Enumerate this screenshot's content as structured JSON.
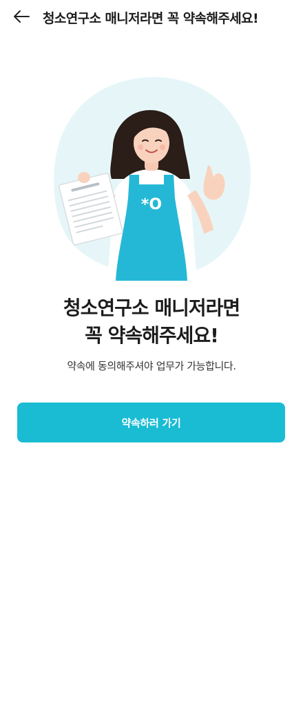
{
  "header": {
    "title": "청소연구소 매니저라면 꼭 약속해주세요!"
  },
  "hero": {
    "title_line1": "청소연구소 매니저라면",
    "title_line2": "꼭 약속해주세요!",
    "subtitle": "약속에 동의해주셔야 업무가 가능합니다."
  },
  "cta": {
    "label": "약속하러 가기"
  },
  "icons": {
    "back": "arrow-left-icon",
    "illustration": "manager-with-document-illustration"
  },
  "colors": {
    "accent": "#19bcd3",
    "blob": "#e6f6f8",
    "apron": "#25b8d6"
  }
}
